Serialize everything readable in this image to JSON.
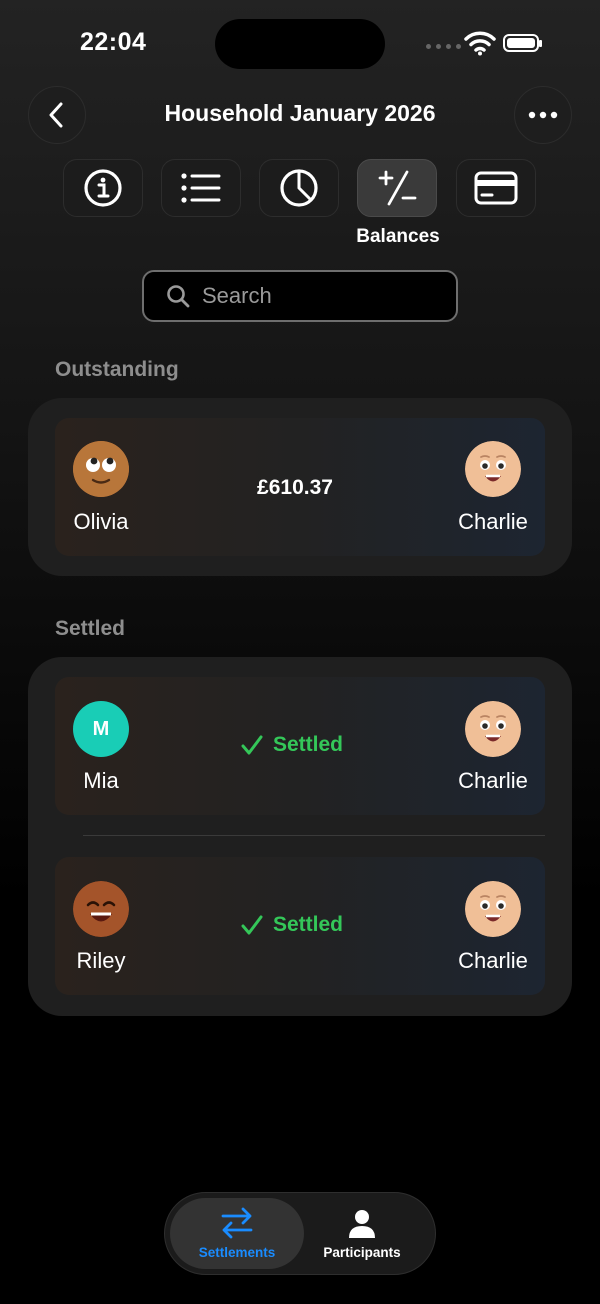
{
  "status_bar": {
    "time": "22:04"
  },
  "header": {
    "title": "Household January 2026"
  },
  "tabs": [
    {
      "icon": "info-icon"
    },
    {
      "icon": "list-icon"
    },
    {
      "icon": "pie-chart-icon"
    },
    {
      "icon": "plus-minus-icon",
      "label": "Balances",
      "active": true
    },
    {
      "icon": "credit-card-icon"
    }
  ],
  "search": {
    "placeholder": "Search"
  },
  "outstanding": {
    "title": "Outstanding",
    "items": [
      {
        "from": "Olivia",
        "to": "Charlie",
        "amount": "£610.37"
      }
    ]
  },
  "settled": {
    "title": "Settled",
    "items": [
      {
        "from": "Mia",
        "from_initial": "M",
        "to": "Charlie",
        "status": "Settled"
      },
      {
        "from": "Riley",
        "to": "Charlie",
        "status": "Settled"
      }
    ]
  },
  "bottom_nav": {
    "items": [
      {
        "label": "Settlements",
        "icon": "arrows-swap-icon",
        "active": true
      },
      {
        "label": "Participants",
        "icon": "person-icon"
      }
    ]
  },
  "colors": {
    "settled_green": "#34c759",
    "accent_blue": "#1a8cff",
    "mia_avatar": "#19cdb6"
  }
}
